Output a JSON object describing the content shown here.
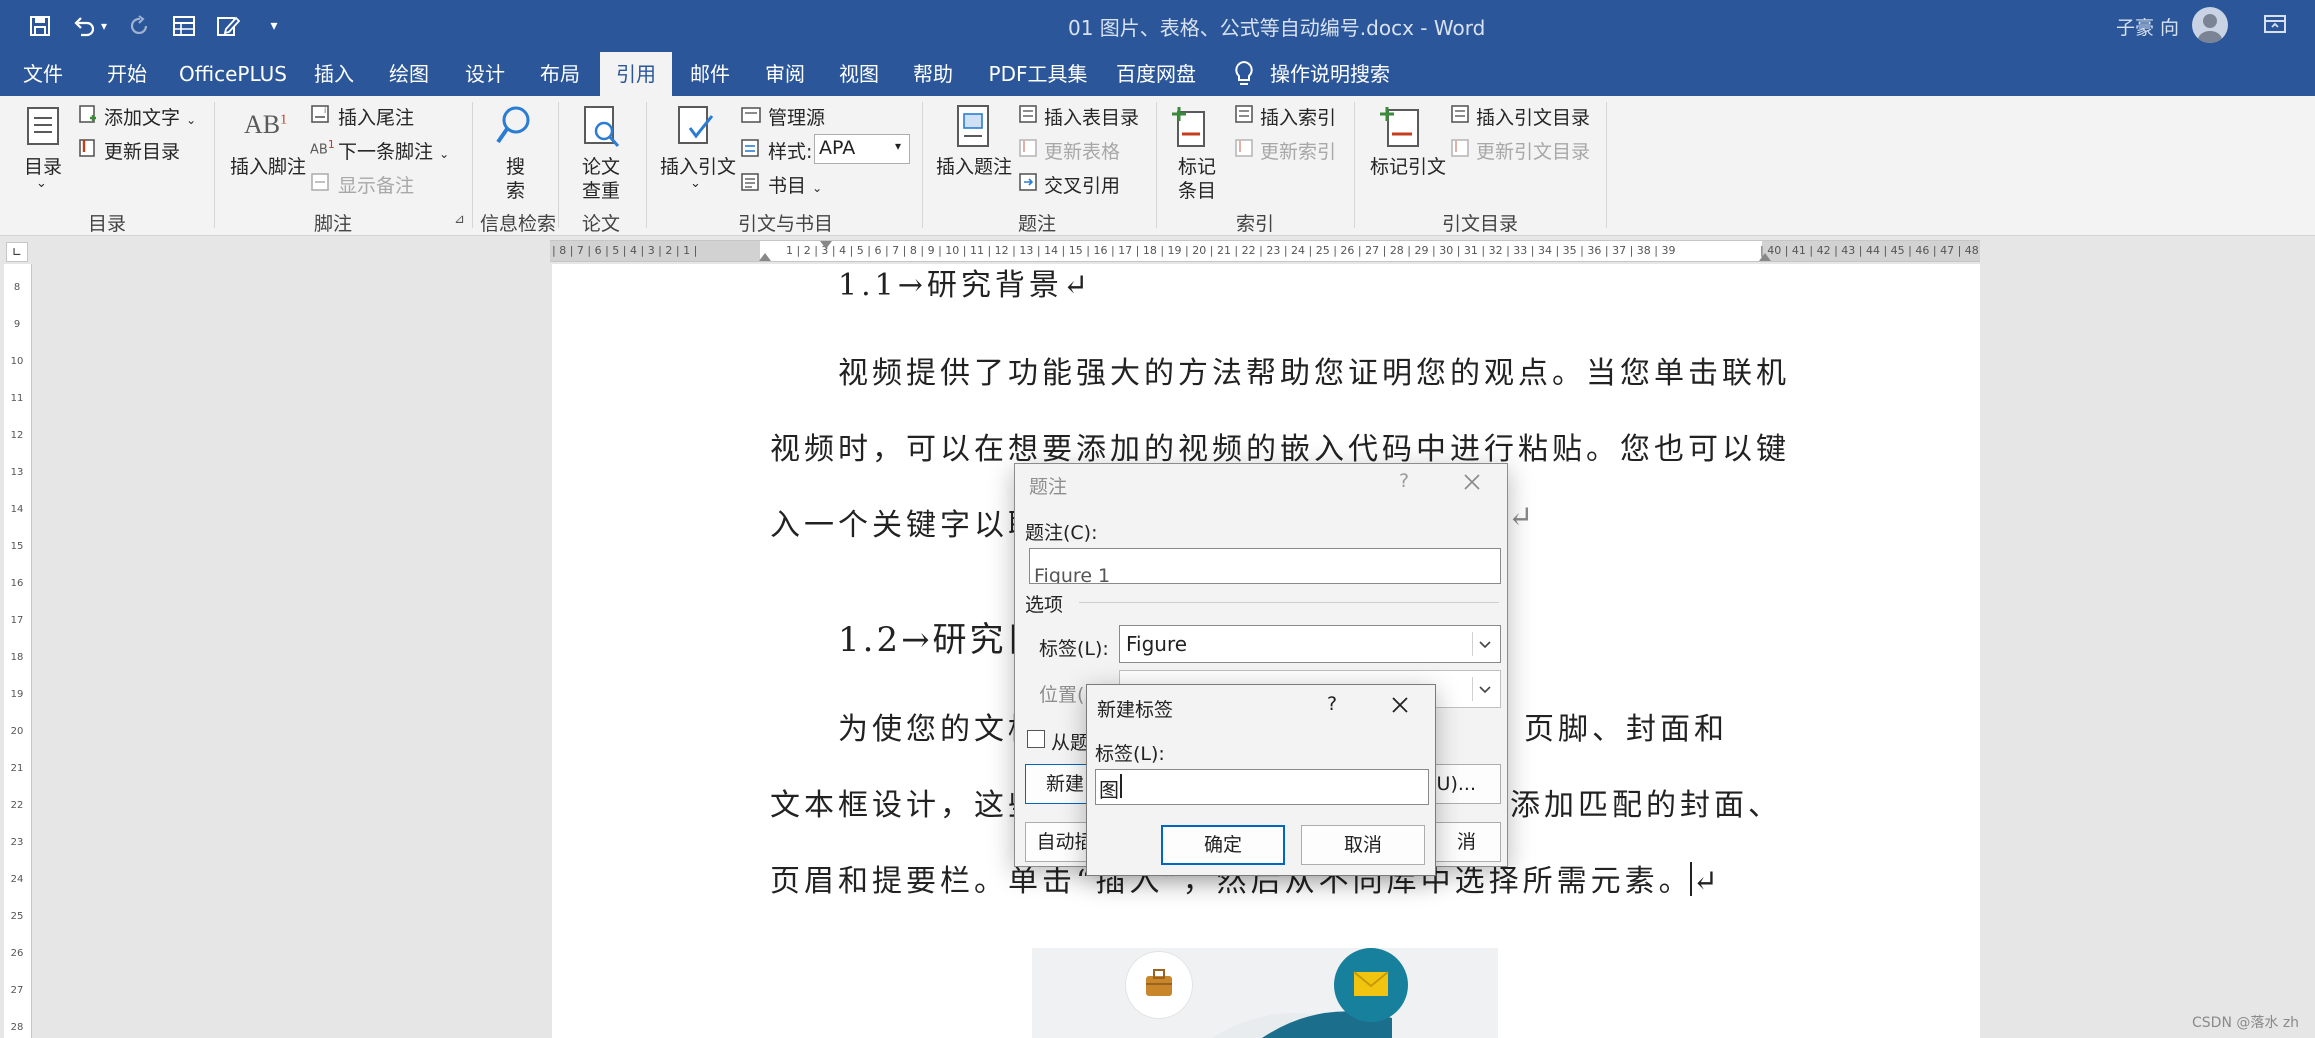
{
  "window": {
    "doc_title": "01 图片、表格、公式等自动编号.docx",
    "separator": "-",
    "app_name": "Word",
    "user_name": "子豪 向"
  },
  "tabs": [
    "文件",
    "开始",
    "OfficePLUS",
    "插入",
    "绘图",
    "设计",
    "布局",
    "引用",
    "邮件",
    "审阅",
    "视图",
    "帮助",
    "PDF工具集",
    "百度网盘"
  ],
  "active_tab": "引用",
  "tell_me": "操作说明搜索",
  "ribbon": {
    "toc": {
      "toc_label": "目录",
      "add_text": "添加文字",
      "update_toc": "更新目录",
      "group": "目录"
    },
    "footnotes": {
      "insert_footnote": "插入脚注",
      "insert_endnote": "插入尾注",
      "next_footnote": "下一条脚注",
      "show_notes": "显示备注",
      "group": "脚注"
    },
    "research": {
      "search": "搜",
      "search2": "索",
      "group": "信息检索"
    },
    "paper": {
      "check": "论文",
      "check2": "查重",
      "group": "论文"
    },
    "citations": {
      "insert_citation": "插入引文",
      "manage_sources": "管理源",
      "style_label": "样式:",
      "style_value": "APA",
      "bibliography": "书目",
      "group": "引文与书目"
    },
    "captions": {
      "insert_caption": "插入题注",
      "insert_tof": "插入表目录",
      "update_table": "更新表格",
      "cross_ref": "交叉引用",
      "group": "题注"
    },
    "index": {
      "mark_entry": "标记",
      "mark_entry2": "条目",
      "insert_index": "插入索引",
      "update_index": "更新索引",
      "group": "索引"
    },
    "toa": {
      "mark_citation": "标记引文",
      "insert_toa": "插入引文目录",
      "update_toa": "更新引文目录",
      "group": "引文目录"
    }
  },
  "ruler": {
    "left_ticks": "| 8 | 7 | 6 | 5 | 4 | 3 | 2 | 1 |",
    "ticks": "1 | 2 | 3 | 4 | 5 | 6 | 7 | 8 | 9 | 10 | 11 | 12 | 13 | 14 | 15 | 16 | 17 | 18 | 19 | 20 | 21 | 22 | 23 | 24 | 25 | 26 | 27 | 28 | 29 | 30 | 31 | 32 | 33 | 34 | 35 | 36 | 37 | 38 | 39",
    "right_ticks": "| 40 | 41 | 42 | 43 | 44 | 45 | 46 | 47 | 48",
    "vertical_ticks": [
      "8",
      "9",
      "10",
      "11",
      "12",
      "13",
      "14",
      "15",
      "16",
      "17",
      "18",
      "19",
      "20",
      "21",
      "22",
      "23",
      "24",
      "25",
      "26",
      "27",
      "28"
    ]
  },
  "document": {
    "heading_1_1": "1.1→研究背景↵",
    "p1_l1": "视频提供了功能强大的方法帮助您证明您的观点。当您单击联机",
    "p1_l2": "视频时，可以在想要添加的视频的嵌入代码中进行粘贴。您也可以键",
    "p1_l3": "入一个关键字以联",
    "p1_end": "↵",
    "heading_1_2": "1.2→研究目",
    "p2_l1a": "为使您的文档",
    "p2_l1b": "眉、页脚、封面和",
    "p2_l2a": "文本框设计，这些",
    "p2_l2b": "添加匹配的封面、",
    "p2_l3": "页眉和提要栏。单击“插入”，然后从不同库中选择所需元素。↵"
  },
  "caption_dialog": {
    "title": "题注",
    "help": "?",
    "caption_label": "题注(C):",
    "caption_value": "Figure 1",
    "options": "选项",
    "label_label": "标签(L):",
    "label_value": "Figure",
    "position_label": "位置(P):",
    "exclude_label": "从题",
    "new_label_btn": "新建",
    "numbering_btn": "(U)...",
    "autocaption_btn": "自动插",
    "cancel_btn": "消"
  },
  "new_label_dialog": {
    "title": "新建标签",
    "help": "?",
    "label_label": "标签(L):",
    "label_value": "图",
    "ok": "确定",
    "cancel": "取消"
  },
  "watermark": "CSDN @落水 zh",
  "colors": {
    "accent": "#2b579a",
    "ribbon_bg": "#f3f3f3",
    "dialog_bg": "#f3f3f3",
    "ok_border": "#0067c0"
  }
}
